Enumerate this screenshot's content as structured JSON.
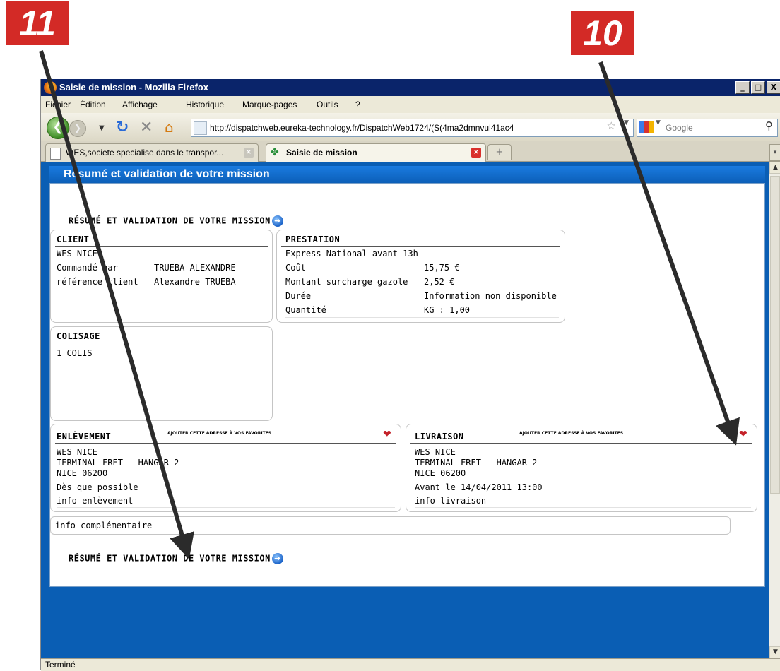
{
  "callouts": {
    "left_label": "11",
    "right_label": "10"
  },
  "window": {
    "title": "Saisie de mission - Mozilla Firefox",
    "minimize": "_",
    "maximize": "□",
    "close": "X"
  },
  "menu": [
    "Fichier",
    "Édition",
    "Affichage",
    "Historique",
    "Marque-pages",
    "Outils",
    "?"
  ],
  "nav": {
    "url": "http://dispatchweb.eureka-technology.fr/DispatchWeb1724/(S(4ma2dmnvul41ac4",
    "search_placeholder": "Google"
  },
  "tabs": [
    {
      "label": "WES,societe specialise dans le transpor...",
      "active": false
    },
    {
      "label": "Saisie de mission",
      "active": true
    }
  ],
  "page": {
    "header": "Résumé et validation de votre mission",
    "section_link": "RÉSUMÉ ET VALIDATION DE VOTRE MISSION",
    "client": {
      "title": "CLIENT",
      "name": "WES NICE",
      "rows": [
        {
          "label": "Commandé par",
          "value": "TRUEBA ALEXANDRE"
        },
        {
          "label": "référence client",
          "value": "Alexandre TRUEBA"
        }
      ]
    },
    "prestation": {
      "title": "PRESTATION",
      "service": "Express National avant 13h",
      "rows": [
        {
          "label": "Coût",
          "value": "15,75 €"
        },
        {
          "label": "Montant surcharge gazole",
          "value": "2,52 €"
        },
        {
          "label": "Durée",
          "value": "Information non disponible"
        },
        {
          "label": "Quantité",
          "value": "KG : 1,00"
        }
      ]
    },
    "colisage": {
      "title": "COLISAGE",
      "value": "1 COLIS"
    },
    "favorites_link": "AJOUTER CETTE ADRESSE À VOS FAVORITES",
    "enlevement": {
      "title": "ENLÈVEMENT",
      "lines": [
        "WES NICE",
        "TERMINAL FRET - HANGAR 2",
        "NICE 06200",
        "Dès que possible",
        "info enlèvement"
      ]
    },
    "livraison": {
      "title": "LIVRAISON",
      "lines": [
        "WES NICE",
        "TERMINAL FRET - HANGAR 2",
        "NICE 06200",
        "Avant le 14/04/2011 13:00",
        "info livraison"
      ]
    },
    "info_complementaire": "info complémentaire"
  },
  "status": "Terminé",
  "colors": {
    "callout": "#d32a26",
    "header_blue": "#0c5fb8",
    "titlebar": "#0a246a"
  }
}
